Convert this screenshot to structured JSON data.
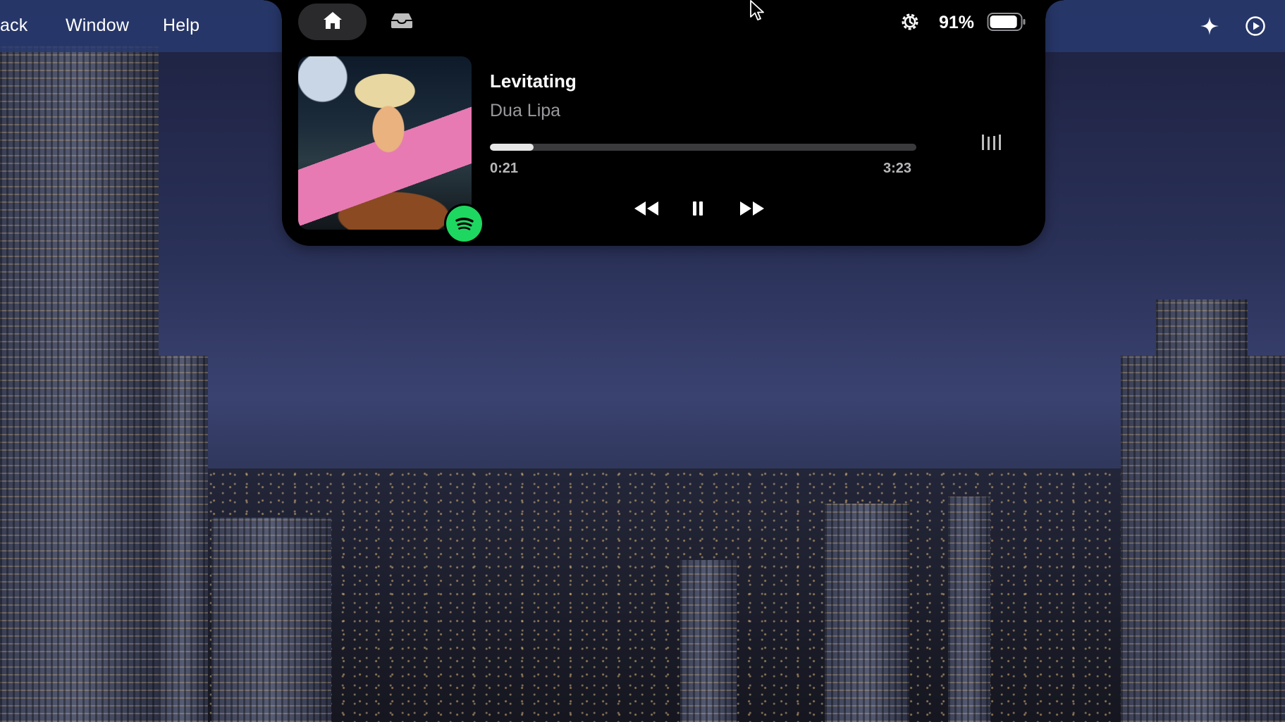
{
  "menubar": {
    "items": [
      {
        "label": "ack"
      },
      {
        "label": "Window"
      },
      {
        "label": "Help"
      }
    ],
    "right_icons": [
      "sparkle-icon",
      "play-circle-icon"
    ]
  },
  "notch": {
    "tabs": [
      {
        "name": "home",
        "icon": "home-icon",
        "active": true
      },
      {
        "name": "tray",
        "icon": "tray-icon",
        "active": false
      }
    ],
    "status": {
      "gear_icon": "gear-icon",
      "battery_percent": "91%",
      "battery_level": 0.91
    },
    "now_playing": {
      "title": "Levitating",
      "artist": "Dua Lipa",
      "elapsed": "0:21",
      "duration": "3:23",
      "progress_fraction": 0.103,
      "source_icon": "spotify-icon",
      "controls": [
        "rewind-icon",
        "pause-icon",
        "fast-forward-icon"
      ],
      "visualizer_icon": "visualizer-icon"
    }
  },
  "colors": {
    "menubar": "#283a6e",
    "notch_bg": "#000000",
    "spotify_green": "#1ed760",
    "progress_track": "#3a3a3c",
    "progress_fill": "#e6e6e6",
    "artist_text": "#9a9a9e"
  }
}
